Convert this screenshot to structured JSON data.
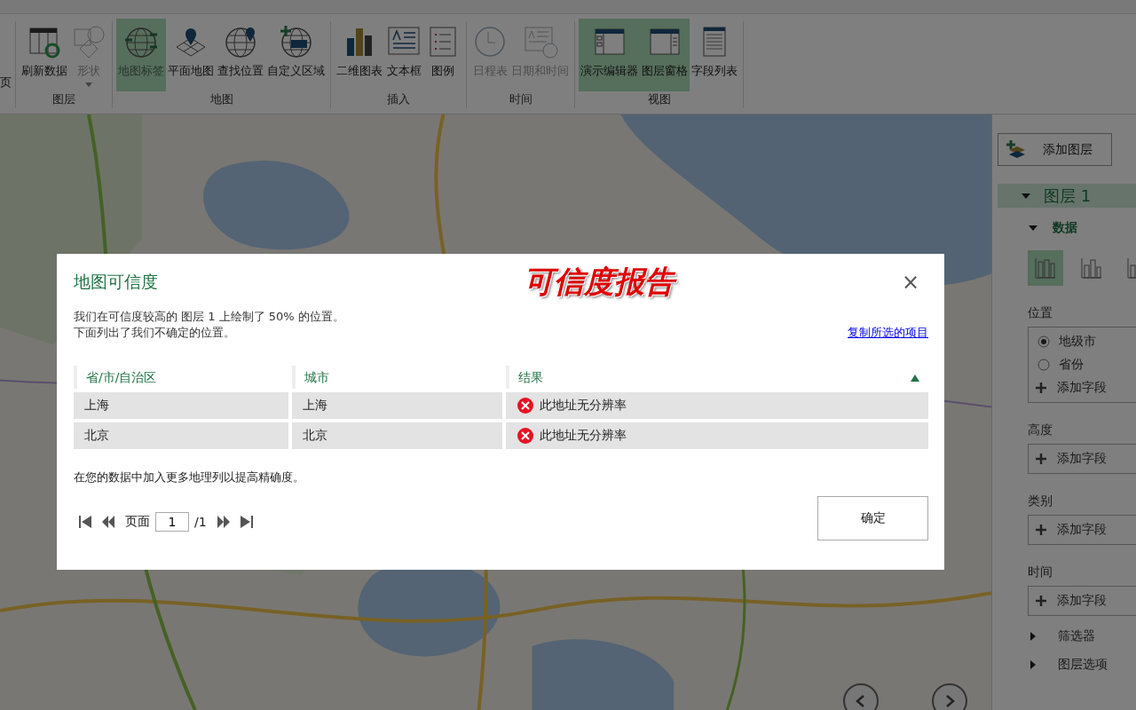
{
  "ribbon": {
    "cut_label": "页",
    "groups": [
      {
        "label": "图层",
        "buttons": [
          {
            "label": "刷新数据",
            "disabled": false,
            "selected": false
          },
          {
            "label": "形状",
            "disabled": true,
            "selected": false,
            "dropdown": true
          }
        ]
      },
      {
        "label": "地图",
        "buttons": [
          {
            "label": "地图标签",
            "disabled": true,
            "selected": true
          },
          {
            "label": "平面地图",
            "disabled": false,
            "selected": false
          },
          {
            "label": "查找位置",
            "disabled": false,
            "selected": false
          },
          {
            "label": "自定义区域",
            "disabled": false,
            "selected": false
          }
        ]
      },
      {
        "label": "插入",
        "buttons": [
          {
            "label": "二维图表",
            "disabled": false,
            "selected": false
          },
          {
            "label": "文本框",
            "disabled": false,
            "selected": false
          },
          {
            "label": "图例",
            "disabled": false,
            "selected": false
          }
        ]
      },
      {
        "label": "时间",
        "buttons": [
          {
            "label": "日程表",
            "disabled": true,
            "selected": false
          },
          {
            "label": "日期和时间",
            "disabled": true,
            "selected": false
          }
        ]
      },
      {
        "label": "视图",
        "buttons": [
          {
            "label": "演示编辑器",
            "disabled": false,
            "selected": true
          },
          {
            "label": "图层窗格",
            "disabled": false,
            "selected": true
          },
          {
            "label": "字段列表",
            "disabled": false,
            "selected": false
          }
        ]
      }
    ]
  },
  "layer_pane": {
    "add_layer": "添加图层",
    "layer": {
      "label": "图层 1",
      "expanded": true
    },
    "data_section": {
      "label": "数据",
      "expanded": true
    },
    "chart_types": [
      {
        "selected": true
      },
      {
        "selected": false
      },
      {
        "selected": false
      }
    ],
    "sections": [
      {
        "label": "位置",
        "radios": [
          {
            "label": "地级市",
            "selected": true
          },
          {
            "label": "省份",
            "selected": false
          }
        ],
        "add_field": "添加字段"
      },
      {
        "label": "高度",
        "add_field": "添加字段"
      },
      {
        "label": "类别",
        "add_field": "添加字段"
      },
      {
        "label": "时间",
        "add_field": "添加字段"
      }
    ],
    "collapsed": [
      {
        "label": "筛选器"
      },
      {
        "label": "图层选项"
      }
    ]
  },
  "dialog": {
    "title": "地图可信度",
    "annotation": "可信度报告",
    "close": "×",
    "message": [
      "我们在可信度较高的 图层 1 上绘制了 50% 的位置。",
      "下面列出了我们不确定的位置。"
    ],
    "copy_link": "复制所选的项目",
    "table": {
      "columns": [
        {
          "label": "省/市/自治区",
          "sorted": false
        },
        {
          "label": "城市",
          "sorted": false
        },
        {
          "label": "结果",
          "sorted": true
        }
      ],
      "rows": [
        {
          "cells": [
            "上海",
            "上海",
            "此地址无分辨率"
          ],
          "error": true
        },
        {
          "cells": [
            "北京",
            "北京",
            "此地址无分辨率"
          ],
          "error": true
        }
      ]
    },
    "hint": "在您的数据中加入更多地理列以提高精确度。",
    "pager": {
      "label": "页面",
      "value": "1",
      "total": "/1"
    },
    "ok": "确定"
  }
}
